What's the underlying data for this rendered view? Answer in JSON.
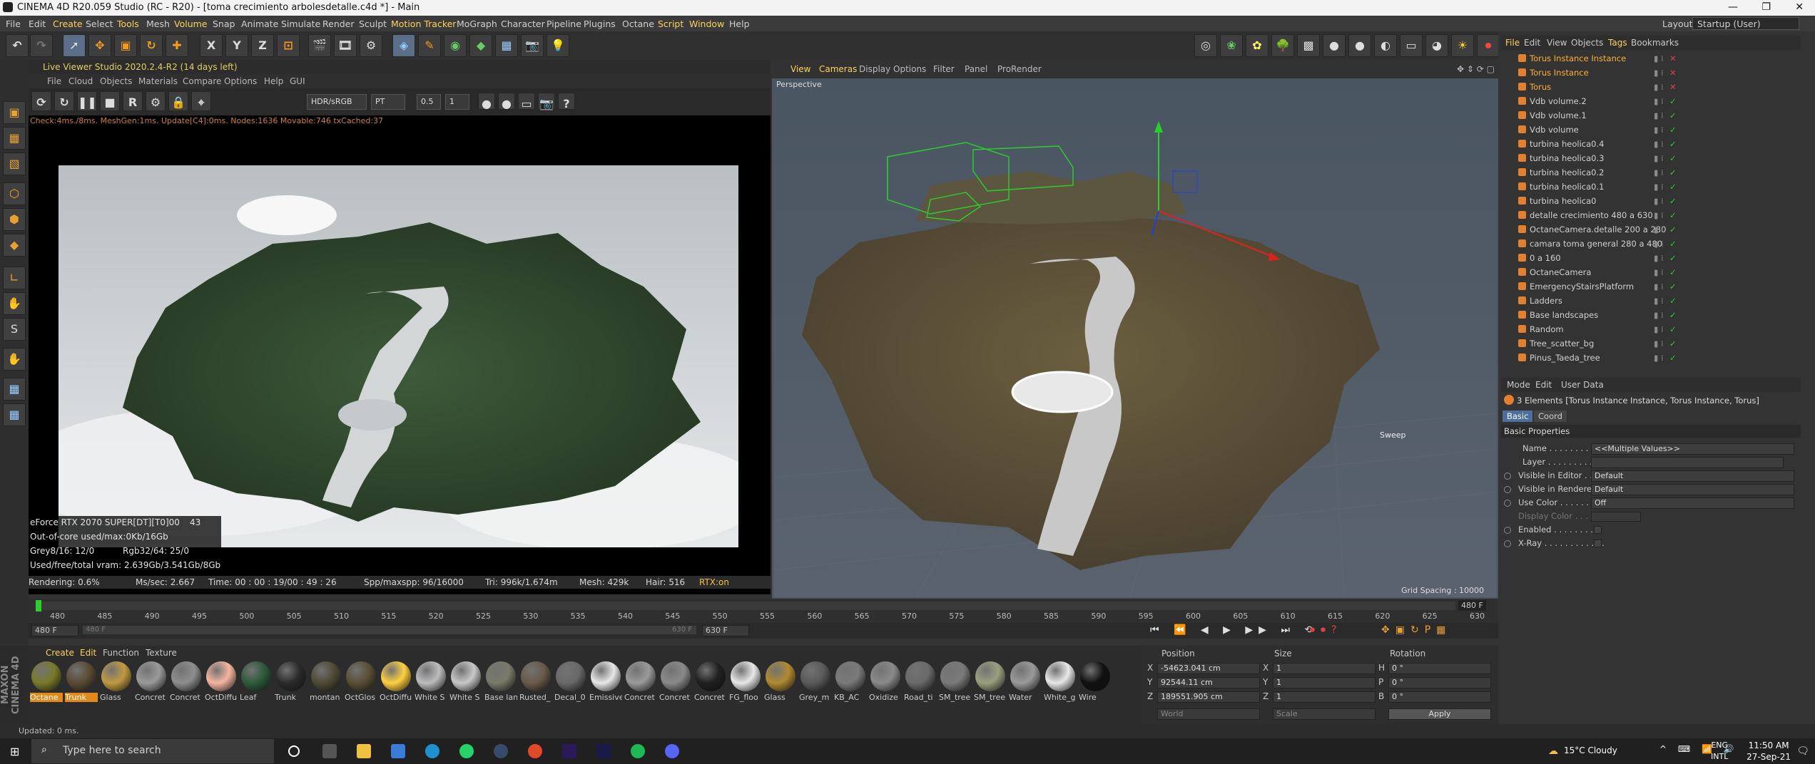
{
  "window": {
    "title": "CINEMA 4D R20.059 Studio (RC - R20) - [toma crecimiento arbolesdetalle.c4d *] - Main",
    "layout_label": "Layout:",
    "layout_value": "Startup (User)"
  },
  "menu": [
    "File",
    "Edit",
    "Create",
    "Select",
    "Tools",
    "Mesh",
    "Volume",
    "Snap",
    "Animate",
    "Simulate",
    "Render",
    "Sculpt",
    "Motion Tracker",
    "MoGraph",
    "Character",
    "Pipeline",
    "Plugins",
    "Octane",
    "Script",
    "Window",
    "Help"
  ],
  "live_viewer": {
    "title": "Live Viewer Studio 2020.2.4-R2 (14 days left)",
    "menu": [
      "File",
      "Cloud",
      "Objects",
      "Materials",
      "Compare",
      "Options",
      "Help",
      "GUI"
    ],
    "tonemap": "HDR/sRGB",
    "kernel": "PT",
    "value1": "0.5",
    "value2": "1",
    "status": "Check:4ms./8ms. MeshGen:1ms. Update[C4]:0ms. Nodes:1636 Movable:746 txCached:37",
    "gpu": [
      "eForce RTX 2070 SUPER[DT][T0]00",
      "43",
      "Out-of-core used/max:0Kb/16Gb",
      "Grey8/16: 12/0",
      "Rgb32/64: 25/0",
      "Used/free/total vram: 2.639Gb/3.541Gb/8Gb"
    ],
    "stats": {
      "rendering": "Rendering: 0.6%",
      "mssec": "Ms/sec: 2.667",
      "time": "Time: 00 : 00 : 19/00 : 49 : 26",
      "spp": "Spp/maxspp: 96/16000",
      "tri": "Tri: 996k/1.674m",
      "mesh": "Mesh: 429k",
      "hair": "Hair: 516",
      "rtx": "RTX:on"
    }
  },
  "viewport": {
    "menu": [
      "View",
      "Cameras",
      "Display",
      "Options",
      "Filter",
      "Panel",
      "ProRender"
    ],
    "label": "Perspective",
    "grid": "Grid Spacing : 10000 cm",
    "sweep": "Sweep"
  },
  "objects": {
    "menu": [
      "File",
      "Edit",
      "View",
      "Objects",
      "Tags",
      "Bookmarks"
    ],
    "items": [
      {
        "name": "Torus Instance Instance",
        "color": "#ffb030"
      },
      {
        "name": "Torus Instance",
        "color": "#ffb030"
      },
      {
        "name": "Torus",
        "color": "#ffb030"
      },
      {
        "name": "Vdb volume.2",
        "color": "#d0d0d0"
      },
      {
        "name": "Vdb volume.1",
        "color": "#d0d0d0"
      },
      {
        "name": "Vdb volume",
        "color": "#d0d0d0"
      },
      {
        "name": "turbina heolica0.4",
        "color": "#d0d0d0"
      },
      {
        "name": "turbina heolica0.3",
        "color": "#d0d0d0"
      },
      {
        "name": "turbina heolica0.2",
        "color": "#d0d0d0"
      },
      {
        "name": "turbina heolica0.1",
        "color": "#d0d0d0"
      },
      {
        "name": "turbina heolica0",
        "color": "#d0d0d0"
      },
      {
        "name": "detalle crecimiento 480 a 630",
        "color": "#d0d0d0"
      },
      {
        "name": "OctaneCamera.detalle 200 a 280",
        "color": "#d0d0d0"
      },
      {
        "name": "camara toma general 280 a 480",
        "color": "#d0d0d0"
      },
      {
        "name": "0 a 160",
        "color": "#d0d0d0"
      },
      {
        "name": "OctaneCamera",
        "color": "#d0d0d0"
      },
      {
        "name": "EmergencyStairsPlatform",
        "color": "#d0d0d0"
      },
      {
        "name": "Ladders",
        "color": "#d0d0d0"
      },
      {
        "name": "Base landscapes",
        "color": "#d0d0d0"
      },
      {
        "name": "Random",
        "color": "#d0d0d0"
      },
      {
        "name": "Tree_scatter_bg",
        "color": "#d0d0d0"
      },
      {
        "name": "Pinus_Taeda_tree",
        "color": "#d0d0d0"
      }
    ]
  },
  "attributes": {
    "menu": [
      "Mode",
      "Edit",
      "User Data"
    ],
    "selection": "3 Elements [Torus Instance Instance, Torus Instance, Torus]",
    "tabs": [
      "Basic",
      "Coord"
    ],
    "section": "Basic Properties",
    "name_label": "Name . . . . . . . . . . . . . .",
    "name_value": "<<Multiple Values>>",
    "layer_label": "Layer . . . . . . . . . . . . . .",
    "vis_editor_label": "Visible in Editor . . .",
    "vis_editor": "Default",
    "vis_render_label": "Visible in Renderer",
    "vis_render": "Default",
    "use_color_label": "Use Color . . . . . . . .",
    "use_color": "Off",
    "display_color_label": "Display Color . . . .",
    "enabled_label": "Enabled . . . . . . . . .",
    "xray_label": "X-Ray . . . . . . . . . . . ."
  },
  "timeline": {
    "ticks": [
      "480",
      "485",
      "490",
      "495",
      "500",
      "505",
      "510",
      "515",
      "520",
      "525",
      "530",
      "535",
      "540",
      "545",
      "550",
      "555",
      "560",
      "565",
      "570",
      "575",
      "580",
      "585",
      "590",
      "595",
      "600",
      "605",
      "610",
      "615",
      "620",
      "625",
      "630"
    ],
    "current": "480 F",
    "start": "480 F",
    "field2": "480 F",
    "end_small": "630 F",
    "end": "630 F"
  },
  "materials": {
    "menu": [
      "Create",
      "Edit",
      "Function",
      "Texture"
    ],
    "items": [
      {
        "name": "Octane",
        "color": "#7a7a2a",
        "selected": true
      },
      {
        "name": "Trunk",
        "color": "#5a4a35",
        "selected": true
      },
      {
        "name": "Glass",
        "color": "#c09a40",
        "selected": false
      },
      {
        "name": "Concret",
        "color": "#9a9a9a",
        "selected": false
      },
      {
        "name": "Concret",
        "color": "#8e8e8e",
        "selected": false
      },
      {
        "name": "OctDiffu",
        "color": "#f5b5a0",
        "selected": false
      },
      {
        "name": "Leaf",
        "color": "#2e5a3a",
        "selected": false
      },
      {
        "name": "Trunk",
        "color": "#2b2b2b",
        "selected": false
      },
      {
        "name": "montan",
        "color": "#4e4a35",
        "selected": false
      },
      {
        "name": "OctGlos",
        "color": "#5a4e35",
        "selected": false
      },
      {
        "name": "OctDiffu",
        "color": "#ffd040",
        "selected": false
      },
      {
        "name": "White S",
        "color": "#bdbdbd",
        "selected": false
      },
      {
        "name": "White S",
        "color": "#c8c8c8",
        "selected": false
      },
      {
        "name": "Base lan",
        "color": "#7a7a6a",
        "selected": false
      },
      {
        "name": "Rusted_",
        "color": "#6a5a4a",
        "selected": false
      },
      {
        "name": "Decal_0",
        "color": "#6a6a6a",
        "selected": false
      },
      {
        "name": "Emissive",
        "color": "#e8e8e8",
        "selected": false
      },
      {
        "name": "Concret",
        "color": "#9a9a9a",
        "selected": false
      },
      {
        "name": "Concret",
        "color": "#8a8a8a",
        "selected": false
      },
      {
        "name": "Concret",
        "color": "#202020",
        "selected": false
      },
      {
        "name": "FG_floo",
        "color": "#e8e8e8",
        "selected": false
      },
      {
        "name": "Glass",
        "color": "#b08a30",
        "selected": false
      },
      {
        "name": "Grey_m",
        "color": "#5a5a5a",
        "selected": false
      },
      {
        "name": "KB_AC",
        "color": "#7a7a7a",
        "selected": false
      },
      {
        "name": "Oxidize",
        "color": "#8a8a8a",
        "selected": false
      },
      {
        "name": "Road_ti",
        "color": "#6a6a6a",
        "selected": false
      },
      {
        "name": "SM_tree",
        "color": "#7a7a7a",
        "selected": false
      },
      {
        "name": "SM_tree",
        "color": "#9aa080",
        "selected": false
      },
      {
        "name": "Water",
        "color": "#9a9a9a",
        "selected": false
      },
      {
        "name": "White_g",
        "color": "#e8e8e8",
        "selected": false
      },
      {
        "name": "Wire",
        "color": "#111111",
        "selected": false
      }
    ]
  },
  "coords": {
    "position": "Position",
    "size": "Size",
    "rotation": "Rotation",
    "x": "-54623.041 cm",
    "y": "92544.11 cm",
    "z": "189551.905 cm",
    "sx": "1",
    "sy": "1",
    "sz": "1",
    "h": "0 °",
    "p": "0 °",
    "b": "0 °",
    "world": "World",
    "scale": "Scale",
    "apply": "Apply"
  },
  "status": "Updated: 0 ms.",
  "taskbar": {
    "search": "Type here to search",
    "weather": "15°C  Cloudy",
    "lang1": "ENG",
    "lang2": "INTL",
    "time": "11:50 AM",
    "date": "27-Sep-21"
  }
}
